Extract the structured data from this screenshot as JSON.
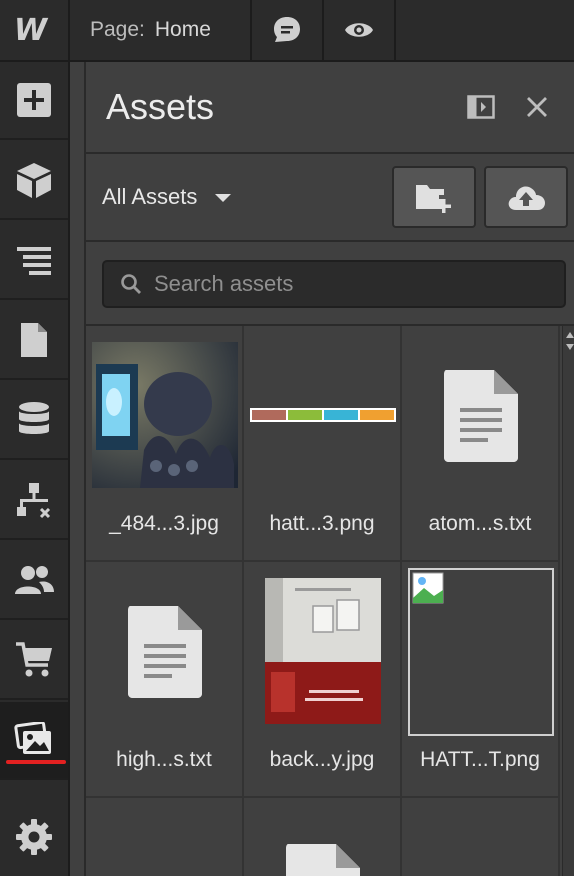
{
  "topbar": {
    "logo": "W",
    "page_label": "Page:",
    "page_name": "Home",
    "comment_icon": "comment-icon",
    "preview_icon": "eye-icon"
  },
  "rail": {
    "items": [
      "add-icon",
      "box-icon",
      "navigator-icon",
      "pages-icon",
      "cms-icon",
      "logic-icon",
      "users-icon",
      "ecommerce-icon",
      "assets-icon",
      "settings-icon"
    ],
    "active": "assets-icon",
    "active_underline_color": "#e32121"
  },
  "panel": {
    "title": "Assets",
    "filter_label": "All Assets",
    "search_placeholder": "Search assets",
    "assets": [
      {
        "name": "_484...3.jpg",
        "kind": "photo-octopus"
      },
      {
        "name": "hatt...3.png",
        "kind": "color-strip"
      },
      {
        "name": "atom...s.txt",
        "kind": "document"
      },
      {
        "name": "high...s.txt",
        "kind": "document"
      },
      {
        "name": "back...y.jpg",
        "kind": "photo-room"
      },
      {
        "name": "HATT...T.png",
        "kind": "broken-image"
      },
      {
        "name": "",
        "kind": "empty"
      },
      {
        "name": "",
        "kind": "document"
      },
      {
        "name": "",
        "kind": "empty"
      }
    ]
  },
  "colors": {
    "bg_panel": "#404040",
    "bg_chrome": "#2b2b2b",
    "text": "#e6e6e6"
  }
}
